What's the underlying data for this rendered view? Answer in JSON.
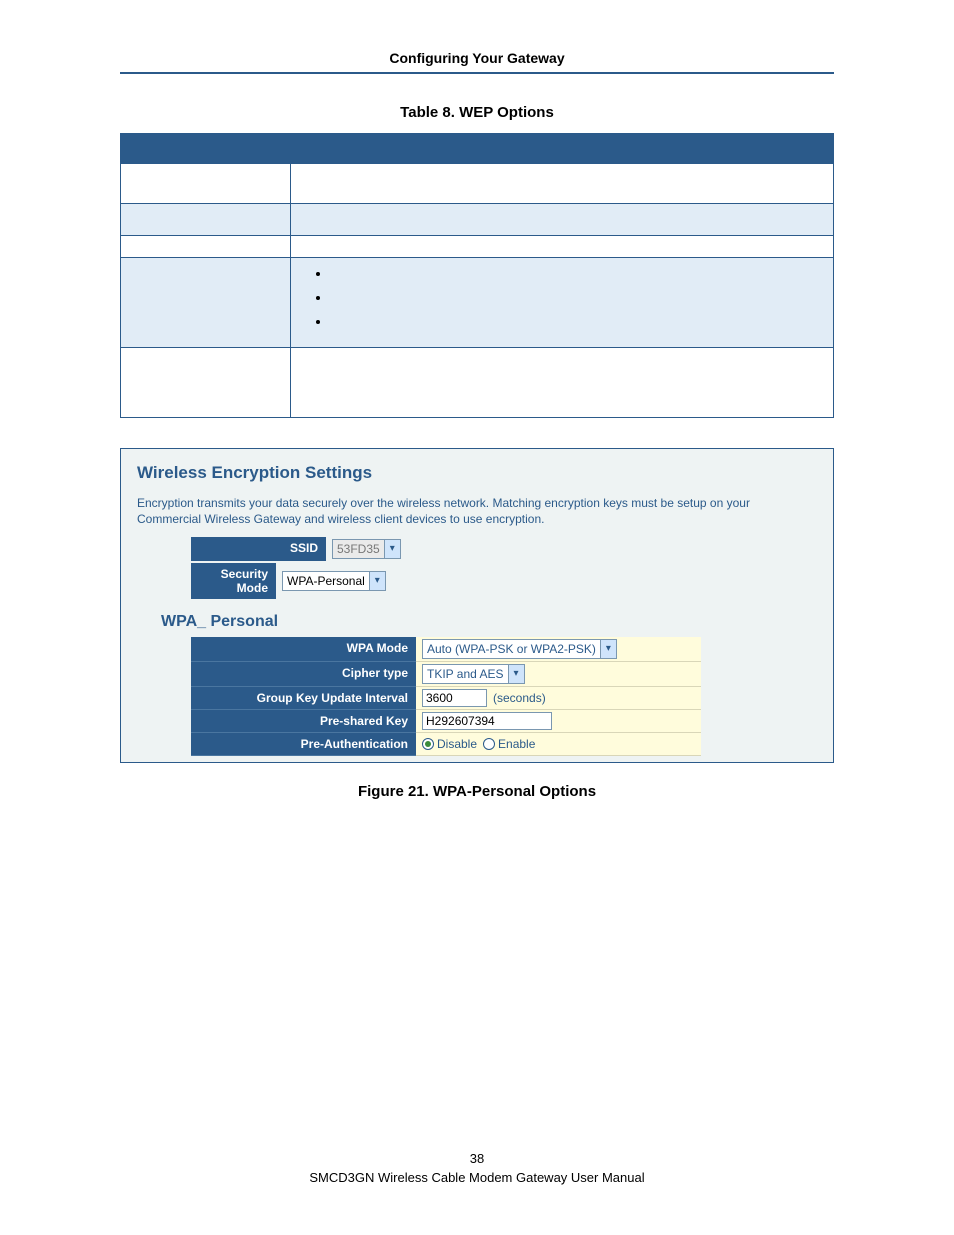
{
  "header": {
    "chapter_title": "Configuring Your Gateway"
  },
  "table": {
    "caption": "Table 8. WEP Options"
  },
  "screenshot": {
    "title": "Wireless Encryption Settings",
    "description": "Encryption transmits your data securely over the wireless network. Matching encryption keys must be setup on your Commercial Wireless Gateway and wireless client devices to use encryption.",
    "ssid_label": "SSID",
    "ssid_value": "53FD35",
    "sec_mode_label": "Security Mode",
    "sec_mode_value": "WPA-Personal",
    "sub_heading": "WPA_ Personal",
    "rows": {
      "wpa_mode": {
        "label": "WPA Mode",
        "value": "Auto (WPA-PSK or WPA2-PSK)"
      },
      "cipher": {
        "label": "Cipher type",
        "value": "TKIP and AES"
      },
      "gku": {
        "label": "Group Key Update Interval",
        "value": "3600",
        "unit": "(seconds)"
      },
      "psk": {
        "label": "Pre-shared Key",
        "value": "H292607394"
      },
      "preauth": {
        "label": "Pre-Authentication",
        "disable": "Disable",
        "enable": "Enable"
      }
    }
  },
  "figure_caption": "Figure 21. WPA-Personal Options",
  "footer": {
    "page_number": "38",
    "manual_title": "SMCD3GN Wireless Cable Modem Gateway User Manual"
  }
}
